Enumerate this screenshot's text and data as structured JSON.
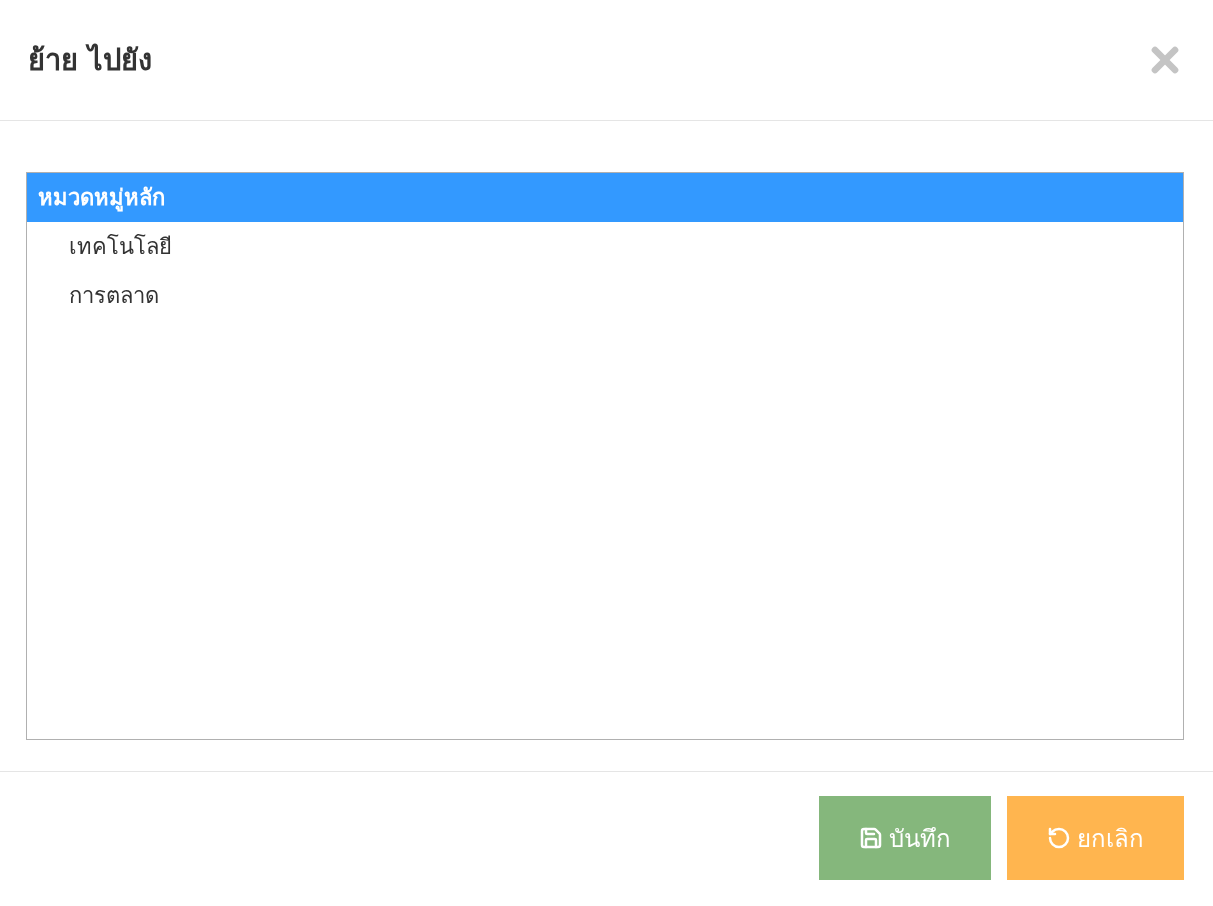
{
  "dialog": {
    "title": "ย้าย ไปยัง"
  },
  "tree": [
    {
      "label": "หมวดหมู่หลัก",
      "selected": true,
      "children": [
        {
          "label": "เทคโนโลยี",
          "selected": false
        },
        {
          "label": "การตลาด",
          "selected": false
        }
      ]
    }
  ],
  "buttons": [
    {
      "kind": "save",
      "label": "บันทึก"
    },
    {
      "kind": "cancel",
      "label": "ยกเลิก"
    }
  ]
}
